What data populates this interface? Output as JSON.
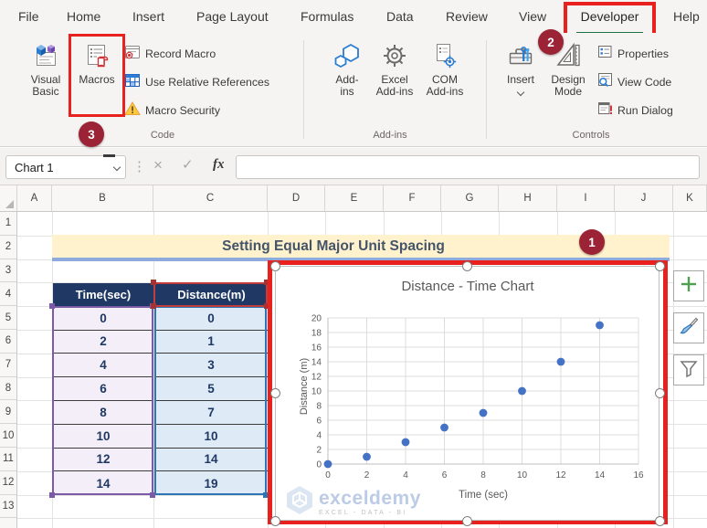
{
  "ribbon": {
    "tabs": [
      "File",
      "Home",
      "Insert",
      "Page Layout",
      "Formulas",
      "Data",
      "Review",
      "View",
      "Developer",
      "Help"
    ],
    "active_tab": "Developer",
    "code_group": {
      "label": "Code",
      "visual_basic": [
        "Visual",
        "Basic"
      ],
      "macros": "Macros",
      "record_macro": "Record Macro",
      "use_relative_references": "Use Relative References",
      "macro_security": "Macro Security"
    },
    "addins_group": {
      "label": "Add-ins",
      "addins": [
        "Add-",
        "ins"
      ],
      "excel_addins": [
        "Excel",
        "Add-ins"
      ],
      "com_addins": [
        "COM",
        "Add-ins"
      ]
    },
    "controls_group": {
      "label": "Controls",
      "insert": "Insert",
      "design_mode": [
        "Design",
        "Mode"
      ],
      "properties": "Properties",
      "view_code": "View Code",
      "run_dialog": "Run Dialog"
    }
  },
  "formula_bar": {
    "name_box_value": "Chart 1",
    "fx_label": "fx",
    "formula_value": "",
    "icons": {
      "separator": "⋮",
      "cancel": "×",
      "enter": "✓"
    }
  },
  "sheet": {
    "column_headers": [
      "A",
      "B",
      "C",
      "D",
      "E",
      "F",
      "G",
      "H",
      "I",
      "J",
      "K"
    ],
    "row_headers": [
      "1",
      "2",
      "3",
      "4",
      "5",
      "6",
      "7",
      "8",
      "9",
      "10",
      "11",
      "12",
      "13"
    ],
    "banner_title": "Setting Equal Major Unit Spacing"
  },
  "table": {
    "headers": [
      "Time(sec)",
      "Distance(m)"
    ],
    "rows": [
      [
        "0",
        "0"
      ],
      [
        "2",
        "1"
      ],
      [
        "4",
        "3"
      ],
      [
        "6",
        "5"
      ],
      [
        "8",
        "7"
      ],
      [
        "10",
        "10"
      ],
      [
        "12",
        "14"
      ],
      [
        "14",
        "19"
      ]
    ]
  },
  "chart_data": {
    "type": "scatter",
    "title": "Distance - Time Chart",
    "xlabel": "Time (sec)",
    "ylabel": "Distance (m)",
    "x": [
      0,
      2,
      4,
      6,
      8,
      10,
      12,
      14
    ],
    "y": [
      0,
      1,
      3,
      5,
      7,
      10,
      14,
      19
    ],
    "xlim": [
      0,
      16
    ],
    "ylim": [
      0,
      20
    ],
    "x_tick_step": 2,
    "y_tick_step": 2,
    "grid": true,
    "legend": "none",
    "point_color": "#4472C4"
  },
  "watermark": {
    "brand": "exceldemy",
    "tagline": "EXCEL - DATA - BI"
  },
  "annotations": {
    "badge_1": "1",
    "badge_2": "2",
    "badge_3": "3"
  },
  "colors": {
    "annotation_red": "#E8201E",
    "badge_maroon": "#9B2335",
    "excel_green": "#1E7145",
    "table_header_fill": "#1F3864",
    "banner_fill": "#FFF2CC",
    "banner_underline": "#8FAADC",
    "time_column_fill": "#F3EEF7",
    "distance_column_fill": "#DEEBF7",
    "purple_selection": "#7B5BA6",
    "blue_selection": "#2E75B6",
    "red_selection": "#C23C3C",
    "chart_point": "#4472C4"
  }
}
